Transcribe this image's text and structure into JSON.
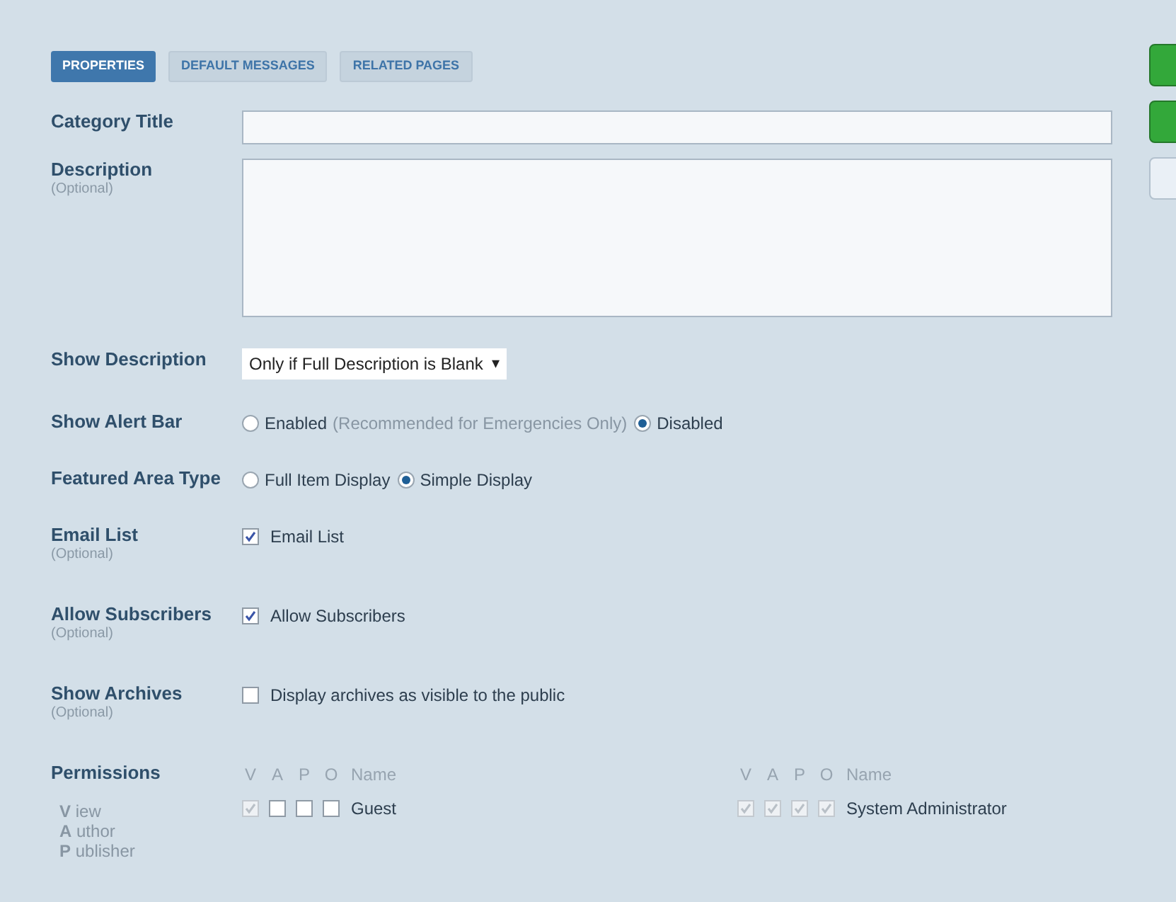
{
  "tabs": [
    {
      "label": "PROPERTIES",
      "selected": true
    },
    {
      "label": "DEFAULT MESSAGES",
      "selected": false
    },
    {
      "label": "RELATED PAGES",
      "selected": false
    }
  ],
  "side_buttons": [
    {
      "kind": "primary"
    },
    {
      "kind": "primary"
    },
    {
      "kind": "secondary"
    }
  ],
  "fields": [
    {
      "kind": "text",
      "label": "Category Title"
    },
    {
      "kind": "textarea",
      "label": "Description",
      "note": "(Optional)"
    },
    {
      "kind": "select",
      "label": "Show Description",
      "value": "Only if Full Description is Blank",
      "arrow": "▾"
    },
    {
      "kind": "radio",
      "label": "Show Alert Bar",
      "options": [
        {
          "label": "Enabled",
          "hint": "(Recommended for Emergencies Only)",
          "selected": false
        },
        {
          "label": "Disabled",
          "selected": true
        }
      ]
    },
    {
      "kind": "radio",
      "label": "Featured Area Type",
      "options": [
        {
          "label": "Full Item Display",
          "selected": false
        },
        {
          "label": "Simple Display",
          "selected": true
        }
      ]
    },
    {
      "kind": "checkbox",
      "label": "Email List",
      "note": "(Optional)",
      "text": "Email List",
      "checked": true
    },
    {
      "kind": "checkbox",
      "label": "Allow Subscribers",
      "note": "(Optional)",
      "text": "Allow Subscribers",
      "checked": true
    },
    {
      "kind": "checkbox",
      "label": "Show Archives",
      "note": "(Optional)",
      "text": "Display archives as visible to the public",
      "checked": false
    }
  ],
  "permissions": {
    "label": "Permissions",
    "legend": [
      "**V** iew",
      "**A** uthor",
      "**P** ublisher"
    ],
    "groups": [
      {
        "headers": [
          "V",
          "A",
          "P",
          "O",
          "Name"
        ],
        "rows": [
          {
            "name": "Guest",
            "checks": [
              true,
              false,
              false,
              false
            ]
          }
        ]
      },
      {
        "headers": [
          "V",
          "A",
          "P",
          "O",
          "Name"
        ],
        "rows": [
          {
            "name": "System Administrator",
            "checks": [
              true,
              true,
              true,
              true
            ]
          }
        ]
      }
    ]
  }
}
